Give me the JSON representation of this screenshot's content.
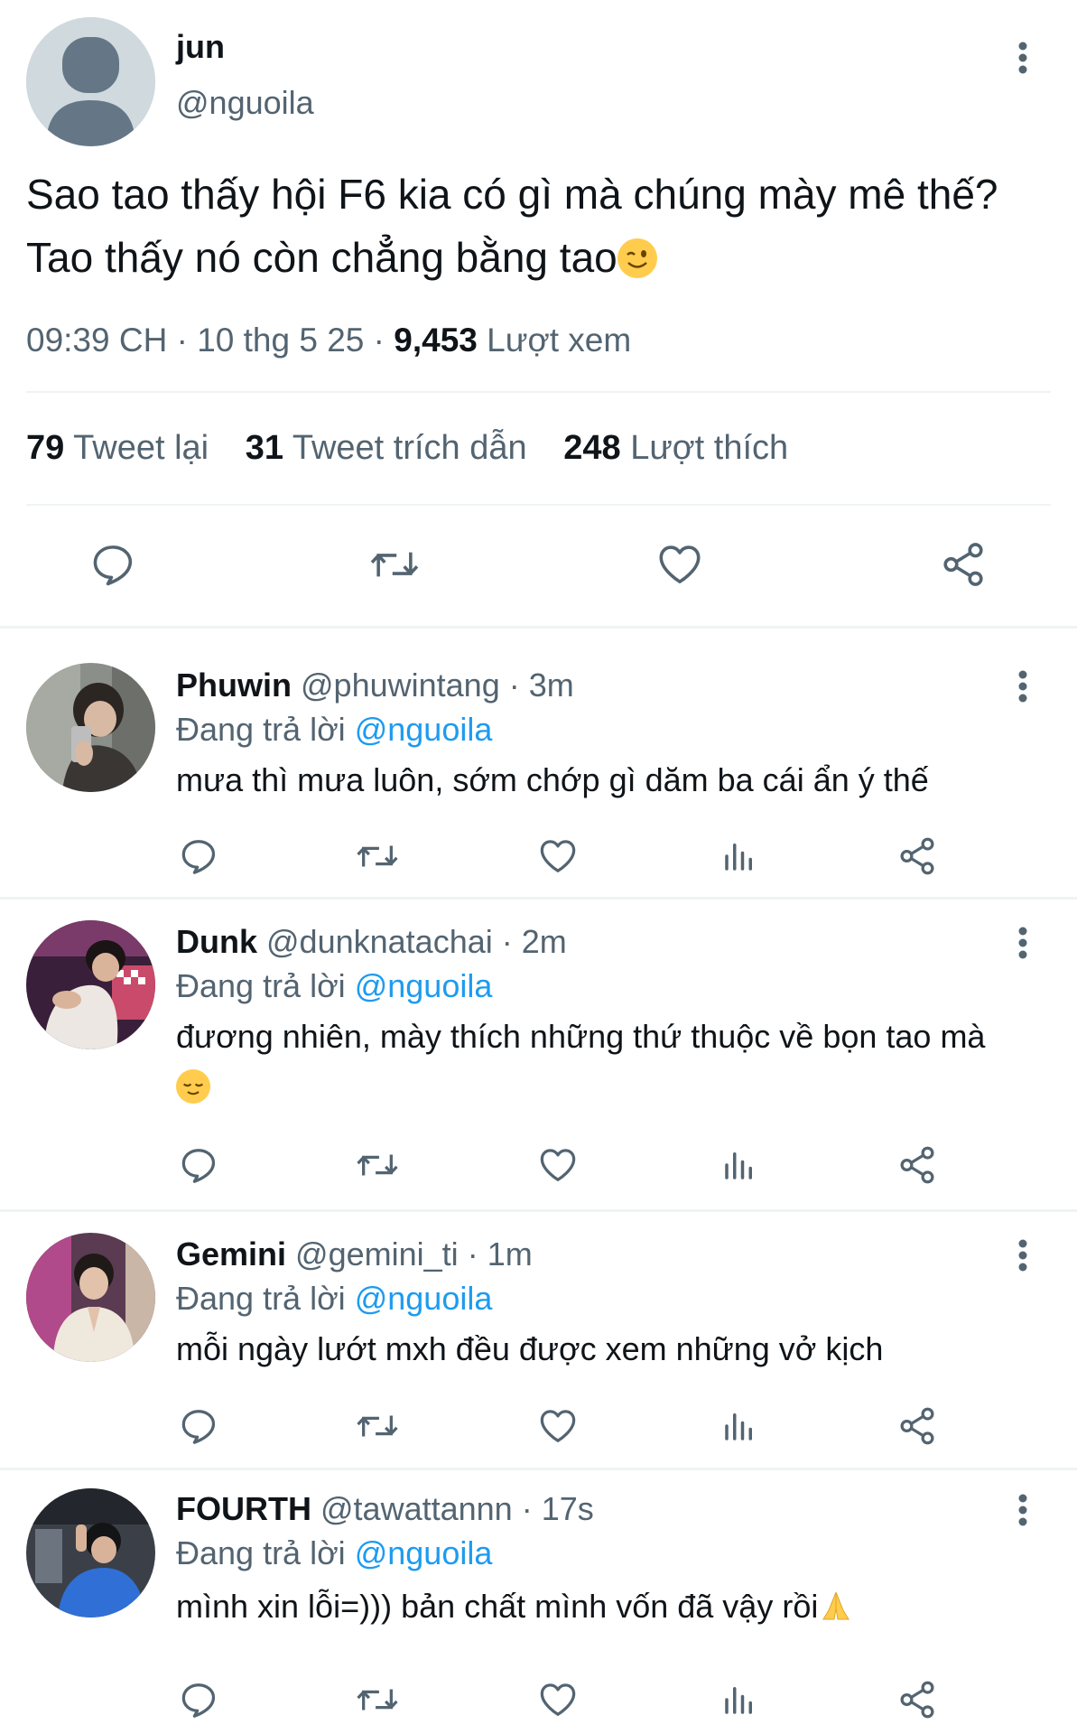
{
  "main_tweet": {
    "name": "jun",
    "handle": "@nguoila",
    "text": "Sao tao thấy hội F6 kia có gì mà chúng mày mê thế? Tao thấy nó còn chẳng bằng tao",
    "text_emoji": "winking-face",
    "time": "09:39 CH",
    "date": "10 thg 5 25",
    "views_count": "9,453",
    "views_label": "Lượt xem",
    "retweets_count": "79",
    "retweets_label": "Tweet lại",
    "quotes_count": "31",
    "quotes_label": "Tweet trích dẫn",
    "likes_count": "248",
    "likes_label": "Lượt thích"
  },
  "replies": [
    {
      "name": "Phuwin",
      "handle": "@phuwintang",
      "time": "3m",
      "replying_label": "Đang trả lời",
      "replying_to": "@nguoila",
      "text": "mưa thì mưa luôn, sớm chớp gì dăm ba cái ẩn ý thế"
    },
    {
      "name": "Dunk",
      "handle": "@dunknatachai",
      "time": "2m",
      "replying_label": "Đang trả lời",
      "replying_to": "@nguoila",
      "text": "đương nhiên, mày thích những thứ thuộc về bọn tao mà",
      "text_emoji": "relieved-face"
    },
    {
      "name": "Gemini",
      "handle": "@gemini_ti",
      "time": "1m",
      "replying_label": "Đang trả lời",
      "replying_to": "@nguoila",
      "text": "mỗi ngày lướt mxh đều được xem những vở kịch"
    },
    {
      "name": "FOURTH",
      "handle": "@tawattannn",
      "time": "17s",
      "replying_label": "Đang trả lời",
      "replying_to": "@nguoila",
      "text": "mình xin lỗi=))) bản chất mình vốn đã vậy rồi",
      "text_emoji": "folded-hands"
    }
  ],
  "separator": "·",
  "icons": [
    "more-icon",
    "reply-icon",
    "retweet-icon",
    "like-icon",
    "share-icon",
    "views-icon"
  ],
  "colors": {
    "text": "#0f1419",
    "secondary": "#536471",
    "link": "#1d9bf0",
    "divider": "#eff3f4"
  }
}
